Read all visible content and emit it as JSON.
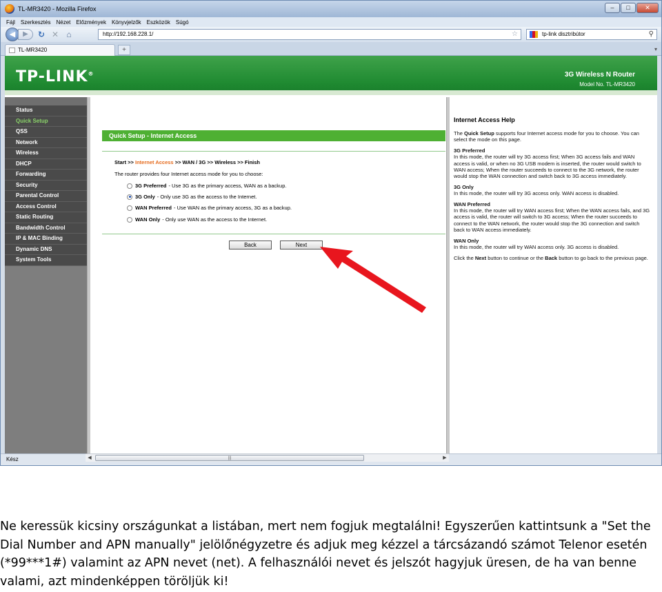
{
  "browser": {
    "title": "TL-MR3420 - Mozilla Firefox",
    "menu": [
      "Fájl",
      "Szerkesztés",
      "Nézet",
      "Előzmények",
      "Könyvjelzők",
      "Eszközök",
      "Súgó"
    ],
    "url": "http://192.168.228.1/",
    "search_text": "tp-link disztribútor",
    "tab_title": "TL-MR3420",
    "newtab_label": "+",
    "status": "Kész"
  },
  "banner": {
    "logo": "TP-LINK",
    "product": "3G Wireless N Router",
    "model": "Model No. TL-MR3420"
  },
  "sidebar": {
    "items": [
      {
        "label": "Status"
      },
      {
        "label": "Quick Setup"
      },
      {
        "label": "QSS"
      },
      {
        "label": "Network"
      },
      {
        "label": "Wireless"
      },
      {
        "label": "DHCP"
      },
      {
        "label": "Forwarding"
      },
      {
        "label": "Security"
      },
      {
        "label": "Parental Control"
      },
      {
        "label": "Access Control"
      },
      {
        "label": "Static Routing"
      },
      {
        "label": "Bandwidth Control"
      },
      {
        "label": "IP & MAC Binding"
      },
      {
        "label": "Dynamic DNS"
      },
      {
        "label": "System Tools"
      }
    ],
    "active_index": 1
  },
  "main": {
    "header": "Quick Setup - Internet Access",
    "crumb_start": "Start >> ",
    "crumb_current": "Internet Access",
    "crumb_rest": " >> WAN / 3G >> Wireless >> Finish",
    "intro": "The router provides four Internet access mode for you to choose:",
    "options": [
      {
        "name": "3G Preferred",
        "desc": "- Use 3G as the primary access, WAN as a backup.",
        "checked": false
      },
      {
        "name": "3G Only",
        "desc": "- Only use 3G as the access to the Internet.",
        "checked": true
      },
      {
        "name": "WAN Preferred",
        "desc": "- Use WAN as the primary access, 3G as a backup.",
        "checked": false
      },
      {
        "name": "WAN Only",
        "desc": "- Only use WAN as the access to the Internet.",
        "checked": false
      }
    ],
    "back_label": "Back",
    "next_label": "Next"
  },
  "help": {
    "title": "Internet Access Help",
    "p1_pre": "The ",
    "p1_bold": "Quick Setup",
    "p1_post": " supports four Internet access mode for you to choose. You can select the mode on this page.",
    "sections": [
      {
        "title": "3G Preferred",
        "text": "In this mode, the router will try 3G access first; When 3G access fails and WAN access is valid, or when no 3G USB modem is inserted, the router would switch to WAN access; When the router succeeds to connect to the 3G network, the router would stop the WAN connection and switch back to 3G access immediately."
      },
      {
        "title": "3G Only",
        "text": "In this mode, the router will try 3G access only. WAN access is disabled."
      },
      {
        "title": "WAN Preferred",
        "text": "In this mode, the router will try WAN access first; When the WAN access fails, and 3G access is valid, the router will switch to 3G access; When the router succeeds to connect to the WAN network, the router would stop the 3G connection and switch back to WAN access immediately."
      },
      {
        "title": "WAN Only",
        "text": "In this mode, the router will try WAN access only. 3G access is disabled."
      }
    ],
    "last_pre": "Click the ",
    "last_next": "Next",
    "last_mid": " button to continue or the ",
    "last_back": "Back",
    "last_post": " button to go back to the previous page."
  },
  "caption": "Ne keressük kicsiny országunkat a listában, mert nem fogjuk megtalálni! Egyszerűen kattintsunk a \"Set the Dial Number and APN manually\" jelölőnégyzetre és adjuk meg kézzel a tárcsázandó számot Telenor esetén (*99***1#) valamint az APN nevet (net). A felhasználói nevet és jelszót hagyjuk üresen, de ha van benne valami, azt mindenképpen töröljük ki!",
  "colors": {
    "banner_green": "#1f8a31",
    "header_green": "#4eb033",
    "active_menu": "#8ad26a",
    "crumb_orange": "#e56a1c",
    "arrow_red": "#e8161e"
  }
}
